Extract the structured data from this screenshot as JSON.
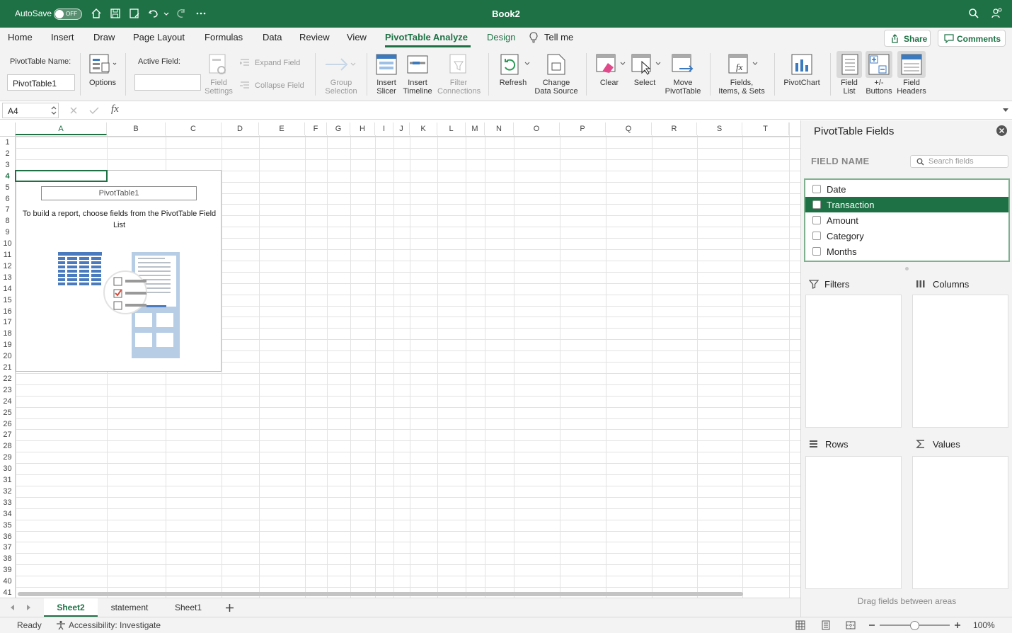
{
  "app": {
    "autosave_label": "AutoSave",
    "autosave_state": "OFF",
    "doc_title": "Book2"
  },
  "tabs": [
    {
      "label": "Home"
    },
    {
      "label": "Insert"
    },
    {
      "label": "Draw"
    },
    {
      "label": "Page Layout"
    },
    {
      "label": "Formulas"
    },
    {
      "label": "Data"
    },
    {
      "label": "Review"
    },
    {
      "label": "View"
    },
    {
      "label": "PivotTable Analyze"
    },
    {
      "label": "Design"
    },
    {
      "label": "Tell me"
    }
  ],
  "header_buttons": {
    "share": "Share",
    "comments": "Comments"
  },
  "ribbon": {
    "pt_name_label": "PivotTable Name:",
    "pt_name_value": "PivotTable1",
    "options": "Options",
    "active_field_label": "Active Field:",
    "active_field_value": "",
    "field_settings_1": "Field",
    "field_settings_2": "Settings",
    "expand_field": "Expand Field",
    "collapse_field": "Collapse Field",
    "group_selection_1": "Group",
    "group_selection_2": "Selection",
    "insert_slicer_1": "Insert",
    "insert_slicer_2": "Slicer",
    "insert_timeline_1": "Insert",
    "insert_timeline_2": "Timeline",
    "filter_connections_1": "Filter",
    "filter_connections_2": "Connections",
    "refresh": "Refresh",
    "change_data_source_1": "Change",
    "change_data_source_2": "Data Source",
    "clear": "Clear",
    "select": "Select",
    "move_pivot_1": "Move",
    "move_pivot_2": "PivotTable",
    "fields_items_1": "Fields,",
    "fields_items_2": "Items, & Sets",
    "pivotchart": "PivotChart",
    "field_list_1": "Field",
    "field_list_2": "List",
    "buttons_1": "+/-",
    "buttons_2": "Buttons",
    "field_headers_1": "Field",
    "field_headers_2": "Headers"
  },
  "formula_bar": {
    "cell_ref": "A4",
    "formula": ""
  },
  "grid": {
    "columns": [
      "A",
      "B",
      "C",
      "D",
      "E",
      "F",
      "G",
      "H",
      "I",
      "J",
      "K",
      "L",
      "M",
      "N",
      "O",
      "P",
      "Q",
      "R",
      "S",
      "T"
    ],
    "rows": [
      "1",
      "2",
      "3",
      "4",
      "5",
      "6",
      "7",
      "8",
      "9",
      "10",
      "11",
      "12",
      "13",
      "14",
      "15",
      "16",
      "17",
      "18",
      "19",
      "20",
      "21",
      "22",
      "23",
      "24",
      "25",
      "26",
      "27",
      "28",
      "29",
      "30",
      "31",
      "32",
      "33",
      "34",
      "35",
      "36",
      "37",
      "38",
      "39",
      "40",
      "41"
    ],
    "selected_cell": "A4"
  },
  "pivot_placeholder": {
    "title": "PivotTable1",
    "message": "To build a report, choose fields from the PivotTable Field List"
  },
  "sheets": [
    {
      "name": "Sheet2",
      "active": true
    },
    {
      "name": "statement",
      "active": false
    },
    {
      "name": "Sheet1",
      "active": false
    }
  ],
  "status": {
    "ready": "Ready",
    "accessibility": "Accessibility: Investigate",
    "zoom": "100%"
  },
  "pane": {
    "title": "PivotTable Fields",
    "field_name_header": "FIELD NAME",
    "search_placeholder": "Search fields",
    "fields": [
      {
        "name": "Date",
        "checked": false,
        "highlighted": false
      },
      {
        "name": "Transaction",
        "checked": false,
        "highlighted": true
      },
      {
        "name": "Amount",
        "checked": false,
        "highlighted": false
      },
      {
        "name": "Category",
        "checked": false,
        "highlighted": false
      },
      {
        "name": "Months",
        "checked": false,
        "highlighted": false
      }
    ],
    "areas": {
      "filters": "Filters",
      "columns": "Columns",
      "rows": "Rows",
      "values": "Values"
    },
    "hint": "Drag fields between areas"
  },
  "colors": {
    "accent": "#1e7145",
    "ribbon_bg": "#f3f3f3"
  }
}
